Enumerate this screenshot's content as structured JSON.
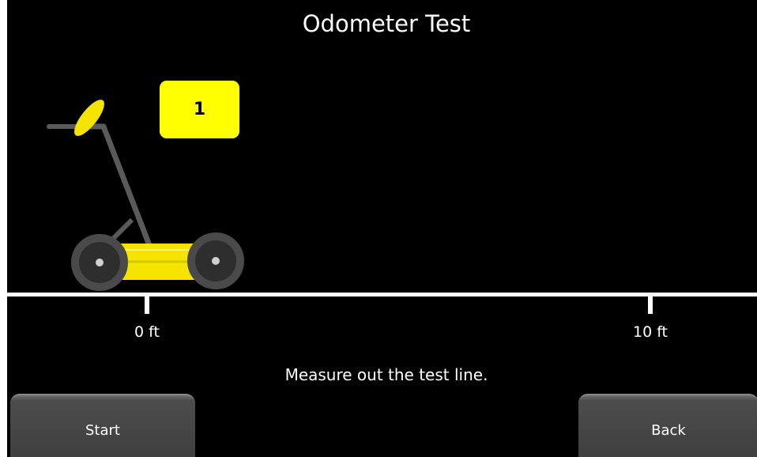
{
  "screen": {
    "title": "Odometer Test",
    "step_number": "1",
    "instruction": "Measure out the test line."
  },
  "ruler": {
    "start_label": "0 ft",
    "end_label": "10 ft"
  },
  "buttons": {
    "start_label": "Start",
    "back_label": "Back"
  },
  "colors": {
    "background": "#000000",
    "accent": "#ffff00",
    "button": "#454545",
    "line": "#ffffff"
  },
  "icons": {
    "cart": "gpr-cart-icon"
  }
}
